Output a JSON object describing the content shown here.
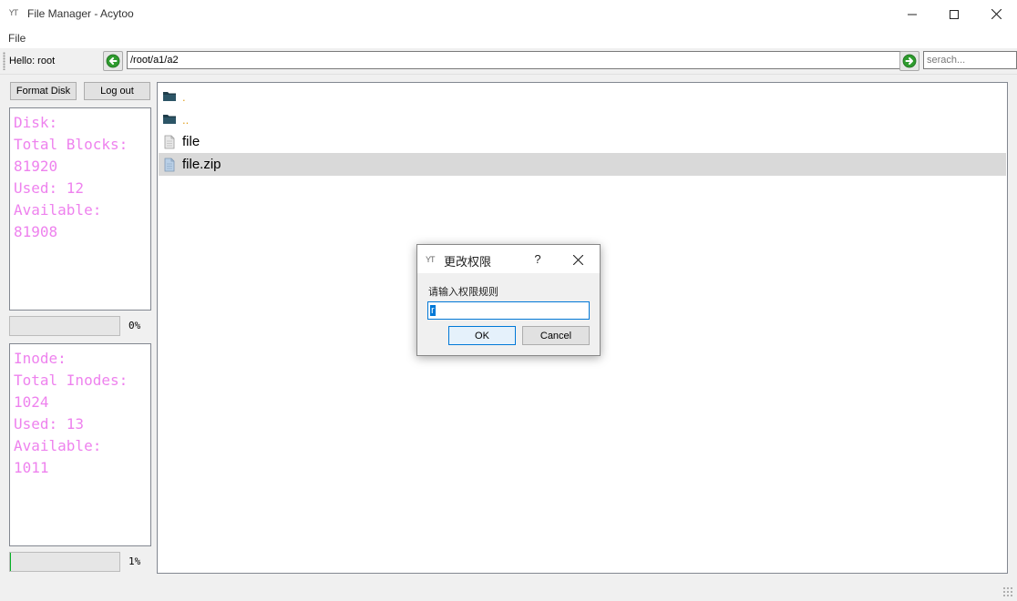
{
  "window": {
    "icon_text": "YT",
    "title": "File Manager - Acytoo"
  },
  "menu": {
    "file": "File"
  },
  "toolbar": {
    "hello": "Hello:  root",
    "path": "/root/a1/a2",
    "search_placeholder": "serach..."
  },
  "left_panel": {
    "format_label": "Format Disk",
    "logout_label": "Log out",
    "disk_lines": [
      "Disk:",
      "Total Blocks:",
      "81920",
      "Used: 12",
      "Available:",
      "81908"
    ],
    "disk_progress": {
      "value": 0,
      "label": "0%"
    },
    "inode_lines": [
      "Inode:",
      "Total Inodes:",
      "1024",
      "Used: 13",
      "Available:",
      "1011"
    ],
    "inode_progress": {
      "value": 1,
      "label": "1%"
    },
    "text_color": "#ee82ee"
  },
  "files": [
    {
      "name": ".",
      "icon": "folder-icon"
    },
    {
      "name": "..",
      "icon": "folder-icon"
    },
    {
      "name": "file",
      "icon": "file-icon"
    },
    {
      "name": "file.zip",
      "icon": "file-icon",
      "selected": true
    }
  ],
  "dialog": {
    "icon_text": "YT",
    "title": "更改权限",
    "help": "?",
    "label": "请输入权限规则",
    "input_value": "r",
    "ok_label": "OK",
    "cancel_label": "Cancel"
  },
  "colors": {
    "accent": "#0078d7",
    "selection": "#d9d9d9",
    "progress": "#06b025",
    "nav_green": "#2e9b2e"
  }
}
